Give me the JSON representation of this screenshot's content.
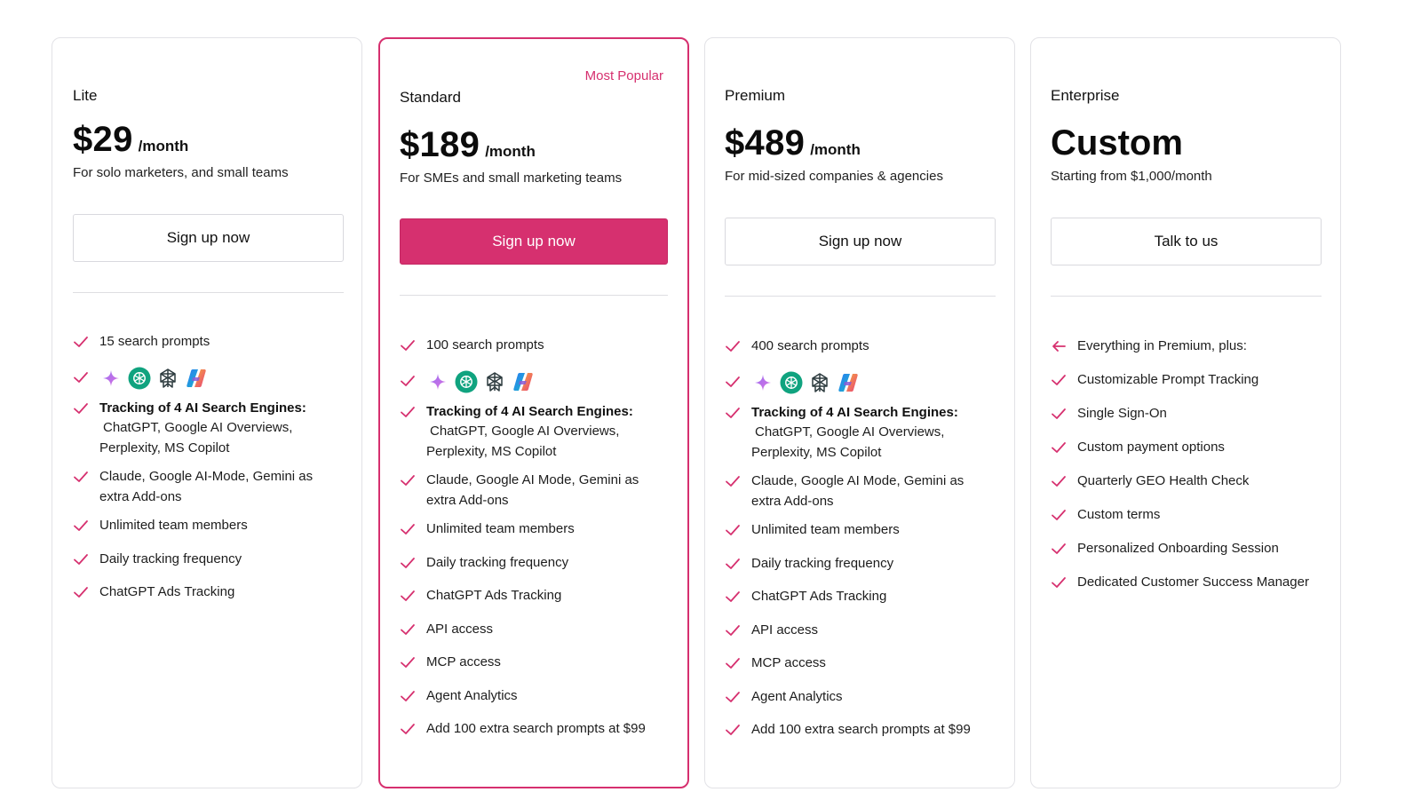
{
  "colors": {
    "accent": "#d6306f",
    "border": "#e2e2e6",
    "check": "#d6306f"
  },
  "engine_icons": [
    "gemini-sparkle-icon",
    "chatgpt-icon",
    "perplexity-icon",
    "copilot-icon"
  ],
  "plans": [
    {
      "name": "Lite",
      "price": "$29",
      "period": "/month",
      "description": "For solo marketers, and small teams",
      "cta": "Sign up now",
      "features": {
        "prompts": "15 search prompts",
        "tracking_title": "Tracking of 4 AI Search Engines:",
        "tracking_engines": "ChatGPT, Google AI Overviews, Perplexity, MS Copilot",
        "addons": "Claude, Google AI-Mode, Gemini as extra Add-ons",
        "team": "Unlimited team members",
        "frequency": "Daily tracking frequency",
        "ads": "ChatGPT Ads Tracking"
      }
    },
    {
      "name": "Standard",
      "badge": "Most Popular",
      "price": "$189",
      "period": "/month",
      "description": "For SMEs and small marketing teams",
      "cta": "Sign up now",
      "features": {
        "prompts": "100 search prompts",
        "tracking_title": "Tracking of 4 AI Search Engines:",
        "tracking_engines": "ChatGPT, Google AI Overviews, Perplexity, MS Copilot",
        "addons": "Claude, Google AI Mode, Gemini as extra Add-ons",
        "team": "Unlimited team members",
        "frequency": "Daily tracking frequency",
        "ads": "ChatGPT Ads Tracking",
        "api": "API access",
        "mcp": "MCP access",
        "agent": "Agent Analytics",
        "extra": "Add 100 extra search prompts at $99"
      }
    },
    {
      "name": "Premium",
      "price": "$489",
      "period": "/month",
      "description": "For mid-sized companies & agencies",
      "cta": "Sign up now",
      "features": {
        "prompts": "400 search prompts",
        "tracking_title": "Tracking of 4 AI Search Engines:",
        "tracking_engines": "ChatGPT, Google AI Overviews, Perplexity, MS Copilot",
        "addons": "Claude, Google AI Mode, Gemini as extra Add-ons",
        "team": "Unlimited team members",
        "frequency": "Daily tracking frequency",
        "ads": "ChatGPT Ads Tracking",
        "api": "API access",
        "mcp": "MCP access",
        "agent": "Agent Analytics",
        "extra": "Add 100 extra search prompts at $99"
      }
    },
    {
      "name": "Enterprise",
      "price": "Custom",
      "description": "Starting from $1,000/month",
      "cta": "Talk to us",
      "features": [
        "Everything in Premium, plus:",
        "Customizable Prompt Tracking",
        "Single Sign-On",
        "Custom payment options",
        "Quarterly GEO Health Check",
        "Custom terms",
        "Personalized Onboarding Session",
        "Dedicated Customer Success Manager"
      ]
    }
  ]
}
